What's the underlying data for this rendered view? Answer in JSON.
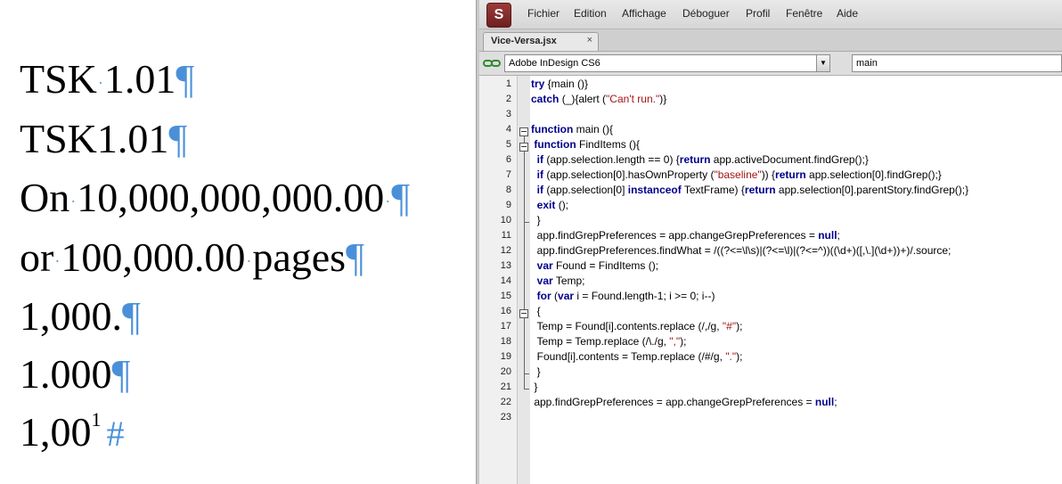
{
  "document": {
    "lines": [
      {
        "parts": [
          "TSK",
          "1.01"
        ]
      },
      {
        "parts": [
          "TSK1.01"
        ]
      },
      {
        "parts": [
          "On",
          "10,000,000,000.00"
        ]
      },
      {
        "parts": [
          "or",
          "100,000.00",
          "pages"
        ]
      },
      {
        "parts": [
          "1,000."
        ]
      },
      {
        "parts": [
          "1.000"
        ]
      },
      {
        "parts": [
          "1,00",
          "1"
        ]
      }
    ],
    "pilcrow": "¶",
    "space_marker": "·",
    "end_marker": "#"
  },
  "estk": {
    "logo": "S",
    "menu": [
      "Fichier",
      "Edition",
      "Affichage",
      "Déboguer",
      "Profil",
      "Fenêtre",
      "Aide"
    ],
    "tab": {
      "label": "Vice-Versa.jsx",
      "close": "×"
    },
    "target": "Adobe InDesign CS6",
    "function": "main",
    "line_numbers": [
      "1",
      "2",
      "3",
      "4",
      "5",
      "6",
      "7",
      "8",
      "9",
      "10",
      "11",
      "12",
      "13",
      "14",
      "15",
      "16",
      "17",
      "18",
      "19",
      "20",
      "21",
      "22",
      "23"
    ],
    "code": [
      "try {main ()}",
      "catch (_){alert (\"Can't run.\")}",
      "",
      "function main (){",
      " function FindItems (){",
      "  if (app.selection.length == 0) {return app.activeDocument.findGrep();}",
      "  if (app.selection[0].hasOwnProperty (\"baseline\")) {return app.selection[0].findGrep();}",
      "  if (app.selection[0] instanceof TextFrame) {return app.selection[0].parentStory.findGrep();}",
      "  exit ();",
      "  }",
      "  app.findGrepPreferences = app.changeGrepPreferences = null;",
      "  app.findGrepPreferences.findWhat = /((?<=\\l\\s)|(?<=\\l)|(?<=^))((\\d+)([,\\.](\\d+))+)/.source;",
      "  var Found = FindItems ();",
      "  var Temp;",
      "  for (var i = Found.length-1; i >= 0; i--)",
      "  {",
      "  Temp = Found[i].contents.replace (/,/g, \"#\");",
      "  Temp = Temp.replace (/\\./g, \",\");",
      "  Found[i].contents = Temp.replace (/#/g, \".\");",
      "  }",
      " }",
      " app.findGrepPreferences = app.changeGrepPreferences = null;",
      ""
    ]
  },
  "colors": {
    "accent": "#4a90d9",
    "keyword": "#00008b",
    "string": "#a31515"
  }
}
